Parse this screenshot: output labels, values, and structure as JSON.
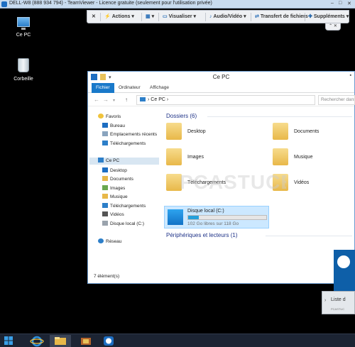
{
  "teamviewer": {
    "title": "DELL-W8 (888 934 794) - TeamViewer - Licence gratuite (seulement pour l'utilisation privée)",
    "toolbar": [
      {
        "icon": "lightning-icon",
        "label": "Actions"
      },
      {
        "icon": "monitor-icon",
        "label": "Visualiser"
      },
      {
        "icon": "speaker-icon",
        "label": "Audio/Vidéo"
      },
      {
        "icon": "transfer-icon",
        "label": "Transfert de fichiers"
      },
      {
        "icon": "plus-icon",
        "label": "Suppléments"
      }
    ]
  },
  "desktop": {
    "icons": [
      {
        "label": "Ce PC",
        "icon": "computer-icon"
      },
      {
        "label": "Corbeille",
        "icon": "recycle-bin-icon"
      }
    ]
  },
  "explorer": {
    "title": "Ce PC",
    "ribbon_tabs": [
      "Fichier",
      "Ordinateur",
      "Affichage"
    ],
    "address": {
      "path": "Ce PC",
      "separator": "›"
    },
    "search_placeholder": "Rechercher dans",
    "nav": {
      "favorites_label": "Favoris",
      "favorites": [
        "Bureau",
        "Emplacements récents",
        "Téléchargements"
      ],
      "pc_label": "Ce PC",
      "pc_items": [
        "Desktop",
        "Documents",
        "Images",
        "Musique",
        "Téléchargements",
        "Vidéos",
        "Disque local (C:)"
      ],
      "network_label": "Réseau"
    },
    "folders_header": "Dossiers (6)",
    "folders": [
      "Desktop",
      "Documents",
      "Images",
      "Musique",
      "Téléchargements",
      "Vidéos"
    ],
    "devices_header": "Périphériques et lecteurs (1)",
    "disk": {
      "name": "Disque local (C:)",
      "free_text": "102 Go libres sur 118 Go",
      "used_fraction": 0.14
    },
    "status": "7 élément(s)"
  },
  "watermark": "PCASTUCES",
  "tv_panel": {
    "list_label": "Liste d",
    "small_text": "PCASTUC"
  },
  "colors": {
    "accent": "#1979ca",
    "folder": "#e8b849",
    "disk_bar": "#26a0da",
    "selection": "#cce8ff"
  }
}
